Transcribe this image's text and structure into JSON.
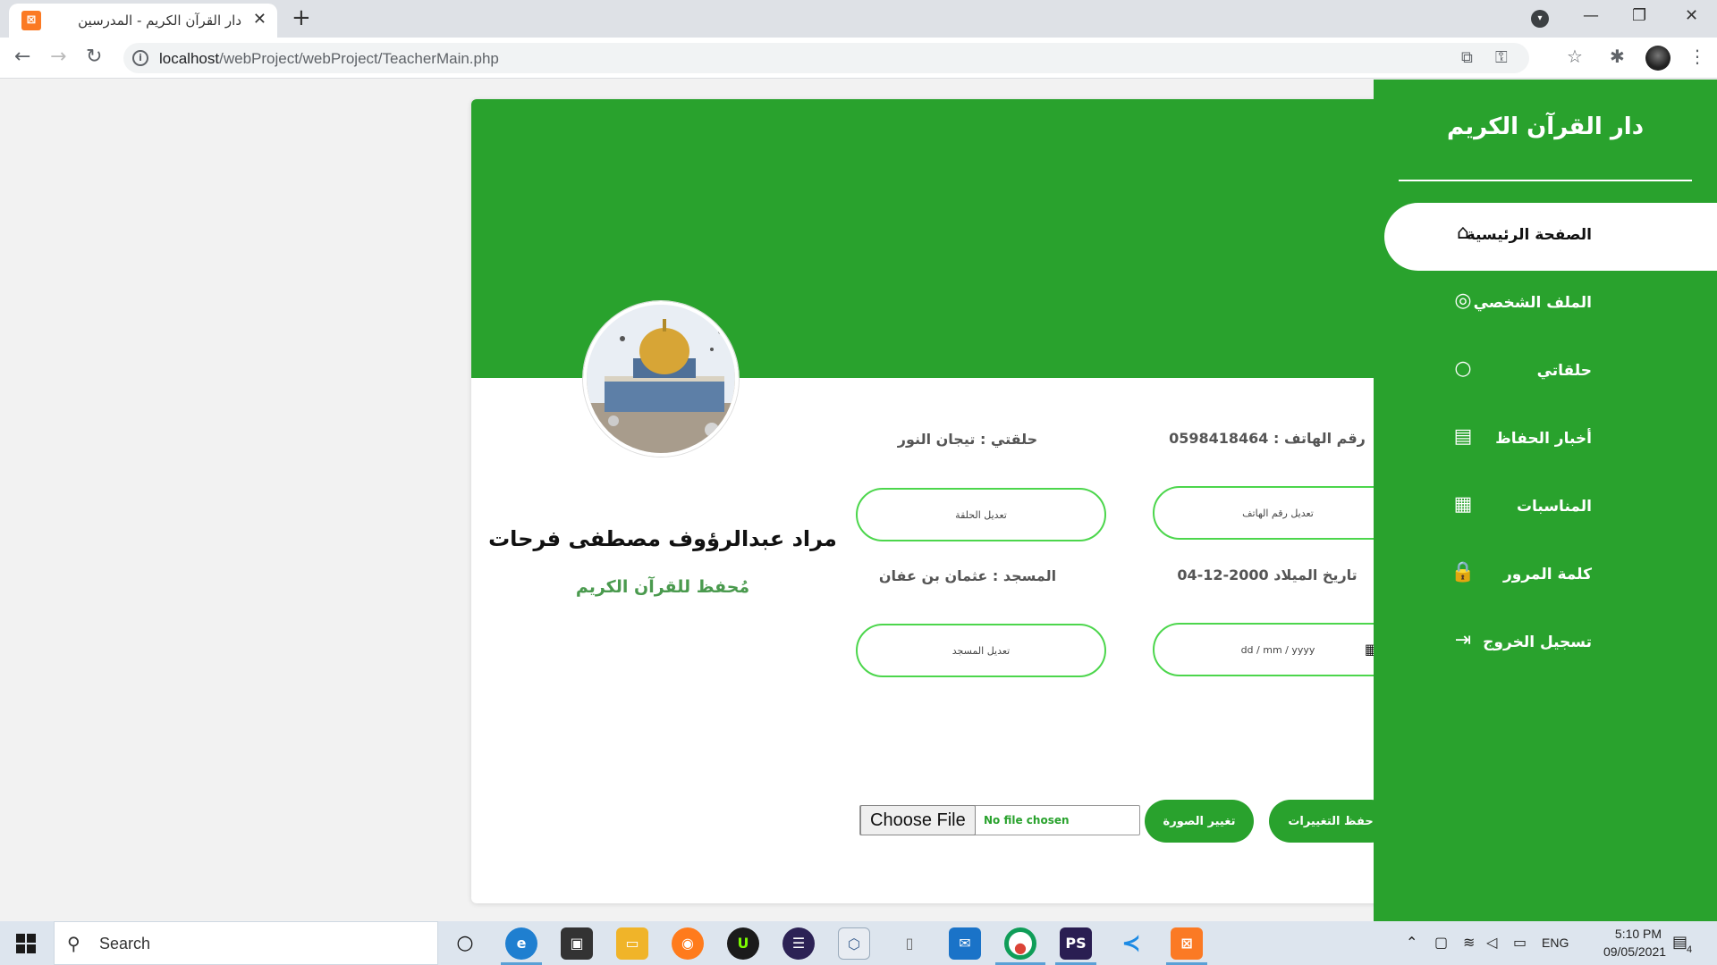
{
  "browser": {
    "tab_title": "دار القرآن الكريم - المدرسين",
    "tab_close": "✕",
    "new_tab": "+",
    "url_host": "localhost",
    "url_path": "/webProject/webProject/TeacherMain.php"
  },
  "sidebar": {
    "brand": "دار القرآن الكريم",
    "items": [
      {
        "label": "الصفحة الرئيسية",
        "icon": "home-icon",
        "glyph": "⌂"
      },
      {
        "label": "الملف الشخصي",
        "icon": "user-circle-icon",
        "glyph": "◎"
      },
      {
        "label": "حلقاتي",
        "icon": "circle-icon",
        "glyph": "○"
      },
      {
        "label": "أخبار الحفاظ",
        "icon": "newspaper-icon",
        "glyph": "▤"
      },
      {
        "label": "المناسبات",
        "icon": "calendar-icon",
        "glyph": "▦"
      },
      {
        "label": "كلمة المرور",
        "icon": "lock-icon",
        "glyph": "🔒"
      },
      {
        "label": "تسجيل الخروج",
        "icon": "logout-icon",
        "glyph": "⇥"
      }
    ]
  },
  "profile": {
    "name": "مراد عبدالرؤوف مصطفى فرحات",
    "role": "مُحفظ للقرآن الكريم"
  },
  "fields": {
    "phone_text": "رقم الهاتف : 0598418464",
    "circle_text": "حلقتي : تيجان النور",
    "edit_phone": "تعديل رقم الهاتف",
    "edit_circle": "تعديل الحلقة",
    "birth_text": "تاريخ الميلاد 2000-12-04",
    "mosque_text": "المسجد : عثمان بن عفان",
    "date_placeholder": "dd / mm / yyyy",
    "edit_mosque": "تعديل المسجد"
  },
  "actions": {
    "choose_file": "Choose File",
    "no_file": "No file chosen",
    "change_photo": "تغيير الصورة",
    "save_changes": "حفظ التغييرات"
  },
  "taskbar": {
    "search_placeholder": "Search",
    "lang": "ENG",
    "time": "5:10 PM",
    "date": "09/05/2021",
    "notifications": "4"
  },
  "colors": {
    "primary_green": "#29a22d",
    "field_border": "#4cd64c",
    "role_green": "#4a9a4e"
  }
}
